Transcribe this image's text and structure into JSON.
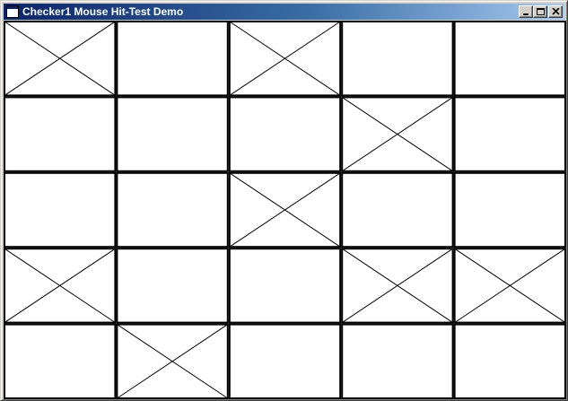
{
  "window": {
    "title": "Checker1 Mouse Hit-Test Demo",
    "buttons": [
      "minimize",
      "maximize",
      "close"
    ],
    "icons": {
      "app": "application-icon",
      "minimize": "minimize-icon",
      "maximize": "maximize-icon",
      "close": "close-icon"
    }
  },
  "grid": {
    "rows": 5,
    "cols": 5,
    "checked": [
      [
        true,
        false,
        true,
        false,
        false
      ],
      [
        false,
        false,
        false,
        true,
        false
      ],
      [
        false,
        false,
        true,
        false,
        false
      ],
      [
        true,
        false,
        false,
        true,
        true
      ],
      [
        false,
        true,
        false,
        false,
        false
      ]
    ]
  },
  "colors": {
    "titlebar_start": "#0a246a",
    "titlebar_end": "#a6caf0",
    "client_background": "#ffffff",
    "grid_line": "#000000"
  }
}
